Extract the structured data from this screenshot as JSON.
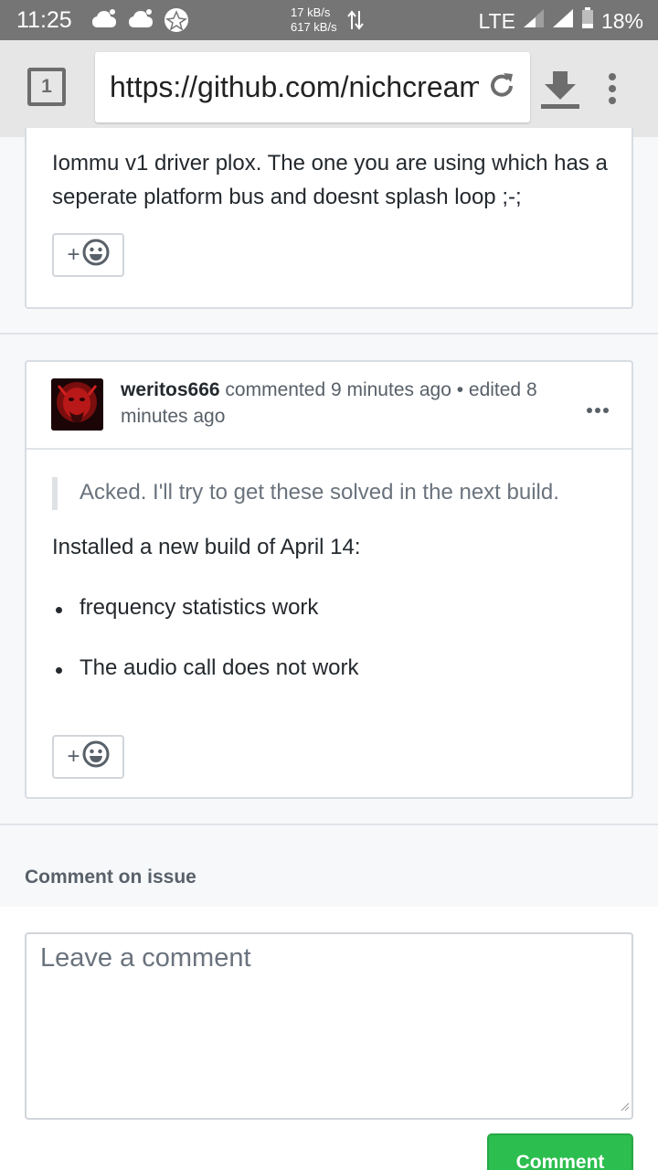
{
  "status_bar": {
    "time": "11:25",
    "speed_up": "17 kB/s",
    "speed_down": "617 kB/s",
    "network": "LTE",
    "battery": "18%"
  },
  "browser": {
    "tab_count": "1",
    "url": "https://github.com/nichcream",
    "icons": [
      "reload-icon",
      "download-icon",
      "menu-icon"
    ]
  },
  "previous_comment": {
    "body": "Iommu v1 driver plox. The one you are using which has a seperate platform bus and doesnt splash loop ;-;",
    "reaction_label": "+"
  },
  "comment": {
    "author": "weritos666",
    "meta_text": "commented 9 minutes ago • edited 8 minutes ago",
    "quote": "Acked. I'll try to get these solved in the next build.",
    "paragraph": "Installed a new build of April 14:",
    "bullets": [
      "frequency statistics work",
      "The audio call does not work"
    ],
    "reaction_label": "+"
  },
  "compose": {
    "title": "Comment on issue",
    "placeholder": "Leave a comment",
    "submit_label": "Comment"
  },
  "colors": {
    "status_bar": "#757575",
    "toolbar": "#e6e6e6",
    "comment_button": "#2cbe4e"
  }
}
